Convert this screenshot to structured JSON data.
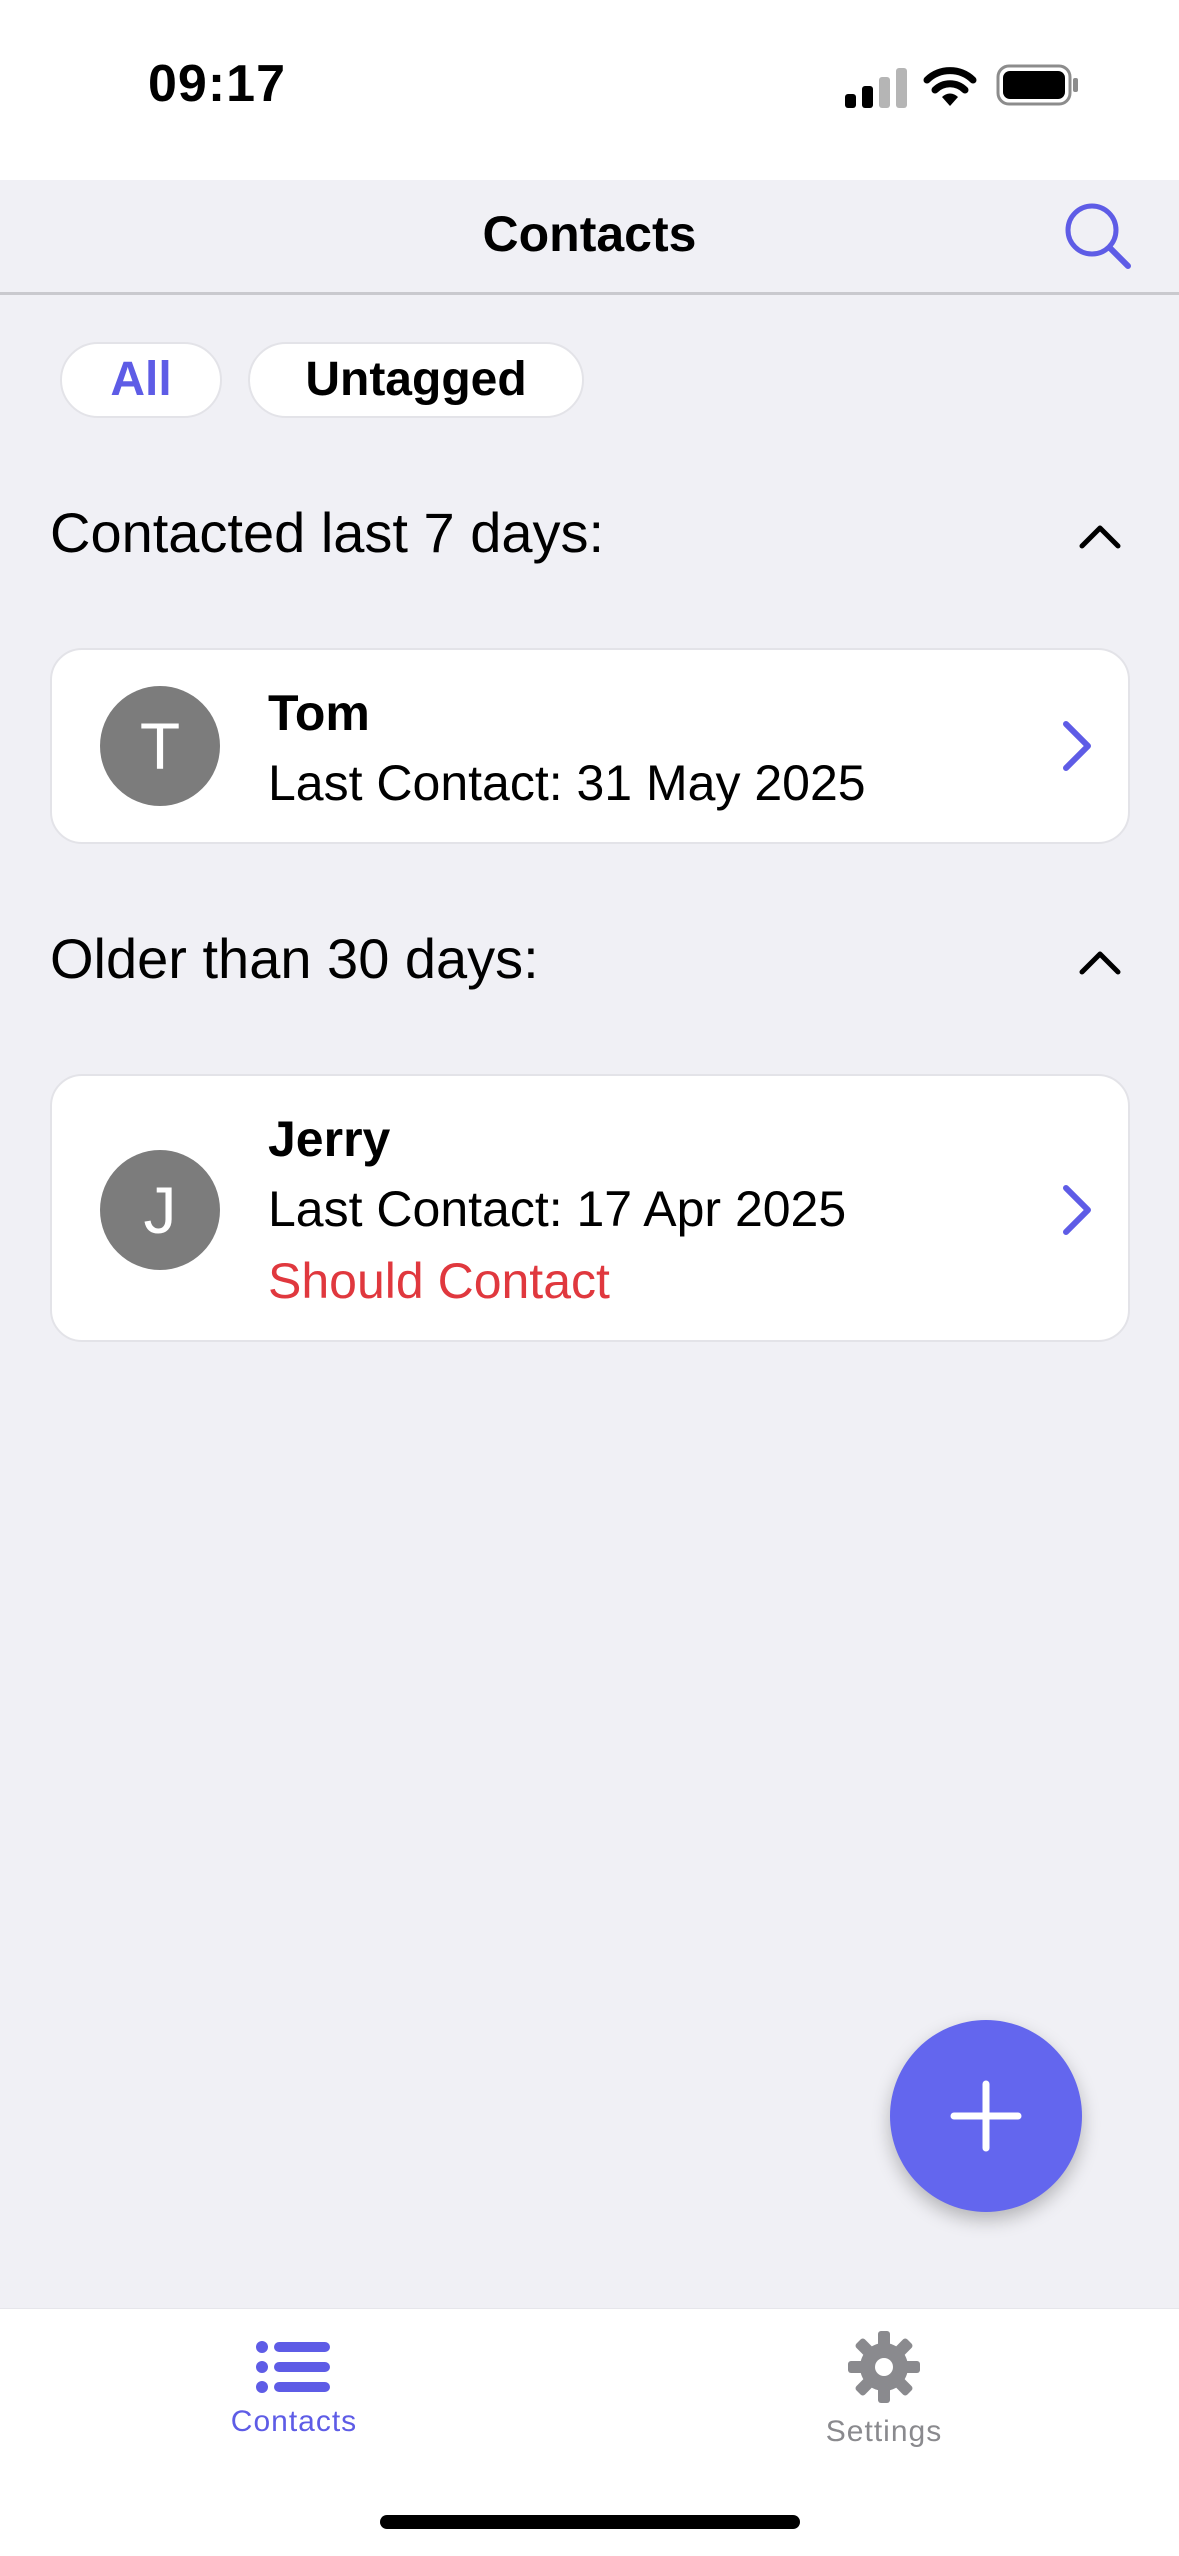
{
  "status_bar": {
    "time": "09:17"
  },
  "nav": {
    "title": "Contacts"
  },
  "filters": [
    {
      "label": "All",
      "selected": true
    },
    {
      "label": "Untagged",
      "selected": false
    }
  ],
  "sections": [
    {
      "title": "Contacted last 7 days:",
      "contacts": [
        {
          "initial": "T",
          "name": "Tom",
          "last_contact": "Last Contact: 31 May 2025"
        }
      ]
    },
    {
      "title": "Older than 30 days:",
      "contacts": [
        {
          "initial": "J",
          "name": "Jerry",
          "last_contact": "Last Contact: 17 Apr 2025",
          "flag": "Should Contact"
        }
      ]
    }
  ],
  "tabs": [
    {
      "label": "Contacts",
      "icon": "list-icon",
      "active": true
    },
    {
      "label": "Settings",
      "icon": "gear-icon",
      "active": false
    }
  ],
  "colors": {
    "accent": "#5E5CE6",
    "fab": "#6366EE",
    "warning": "#E0383E",
    "background": "#F0F0F5",
    "avatar": "#7C7C7C"
  }
}
